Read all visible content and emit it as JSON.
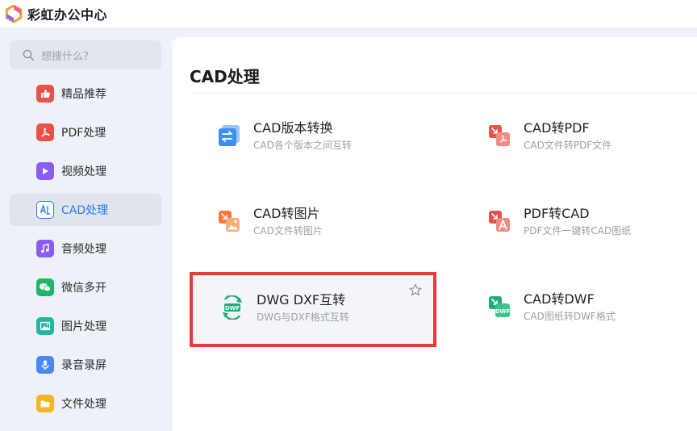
{
  "app": {
    "title": "彩虹办公中心"
  },
  "search": {
    "placeholder": "想搜什么?"
  },
  "sidebar": {
    "items": [
      {
        "label": "精品推荐",
        "icon": "thumbs-up-icon",
        "color": "#e8524a",
        "active": false
      },
      {
        "label": "PDF处理",
        "icon": "pdf-icon",
        "color": "#e8524a",
        "active": false
      },
      {
        "label": "视频处理",
        "icon": "play-icon",
        "color": "#8a5cf0",
        "active": false
      },
      {
        "label": "CAD处理",
        "icon": "cad-icon",
        "color": "#2d7be8",
        "active": true
      },
      {
        "label": "音频处理",
        "icon": "music-note-icon",
        "color": "#8a5cf0",
        "active": false
      },
      {
        "label": "微信多开",
        "icon": "wechat-icon",
        "color": "#1fb86a",
        "active": false
      },
      {
        "label": "图片处理",
        "icon": "image-icon",
        "color": "#20b8a0",
        "active": false
      },
      {
        "label": "录音录屏",
        "icon": "microphone-icon",
        "color": "#4a8af0",
        "active": false
      },
      {
        "label": "文件处理",
        "icon": "folder-icon",
        "color": "#f5b524",
        "active": false
      }
    ]
  },
  "main": {
    "title": "CAD处理",
    "tools": [
      {
        "title": "CAD版本转换",
        "desc": "CAD各个版本之间互转",
        "icon": "version-convert-icon"
      },
      {
        "title": "CAD转PDF",
        "desc": "CAD文件转PDF文件",
        "icon": "cad-to-pdf-icon"
      },
      {
        "title": "CAD转图片",
        "desc": "CAD文件转图片",
        "icon": "cad-to-image-icon"
      },
      {
        "title": "PDF转CAD",
        "desc": "PDF文件一键转CAD图纸",
        "icon": "pdf-to-cad-icon"
      },
      {
        "title": "DWG DXF互转",
        "desc": "DWG与DXF格式互转",
        "icon": "dwg-dxf-icon",
        "highlighted": true
      },
      {
        "title": "CAD转DWF",
        "desc": "CAD图纸转DWF格式",
        "icon": "cad-to-dwf-icon"
      }
    ]
  },
  "colors": {
    "accent": "#2d7be8",
    "highlight_frame": "#e83a3a"
  }
}
